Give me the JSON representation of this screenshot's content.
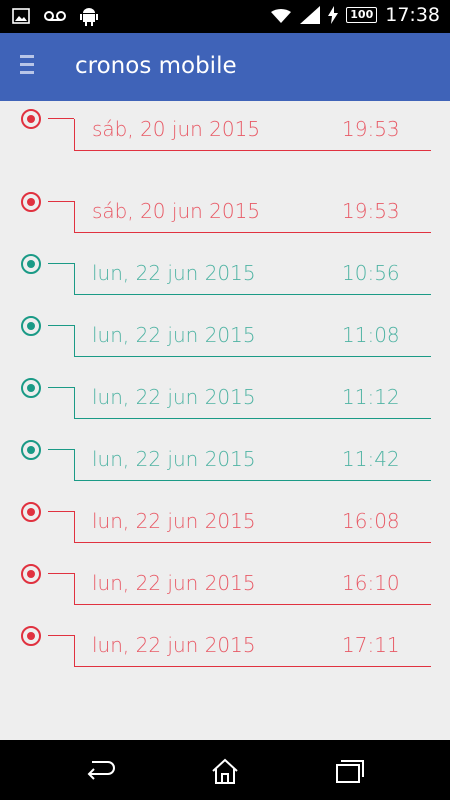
{
  "status": {
    "time": "17:38",
    "battery": "100",
    "icons": [
      "image-icon",
      "voicemail-icon",
      "android-icon",
      "wifi-icon",
      "signal-icon",
      "charging-icon",
      "battery-icon"
    ]
  },
  "appbar": {
    "title": "cronos mobile",
    "menu_icon": "hamburger-icon"
  },
  "colors": {
    "appbar": "#3f63b8",
    "in": "#1a9a86",
    "out": "#e0313f"
  },
  "entries": [
    {
      "date": "sáb, 20 jun 2015",
      "time": "19:53",
      "status": "out"
    },
    {
      "date": "sáb, 20 jun 2015",
      "time": "19:53",
      "status": "out"
    },
    {
      "date": "lun, 22 jun 2015",
      "time": "10:56",
      "status": "in"
    },
    {
      "date": "lun, 22 jun 2015",
      "time": "11:08",
      "status": "in"
    },
    {
      "date": "lun, 22 jun 2015",
      "time": "11:12",
      "status": "in"
    },
    {
      "date": "lun, 22 jun 2015",
      "time": "11:42",
      "status": "in"
    },
    {
      "date": "lun, 22 jun 2015",
      "time": "16:08",
      "status": "out"
    },
    {
      "date": "lun, 22 jun 2015",
      "time": "16:10",
      "status": "out"
    },
    {
      "date": "lun, 22 jun 2015",
      "time": "17:11",
      "status": "out"
    }
  ],
  "navbar": {
    "icons": [
      "back-icon",
      "home-icon",
      "recents-icon"
    ]
  }
}
